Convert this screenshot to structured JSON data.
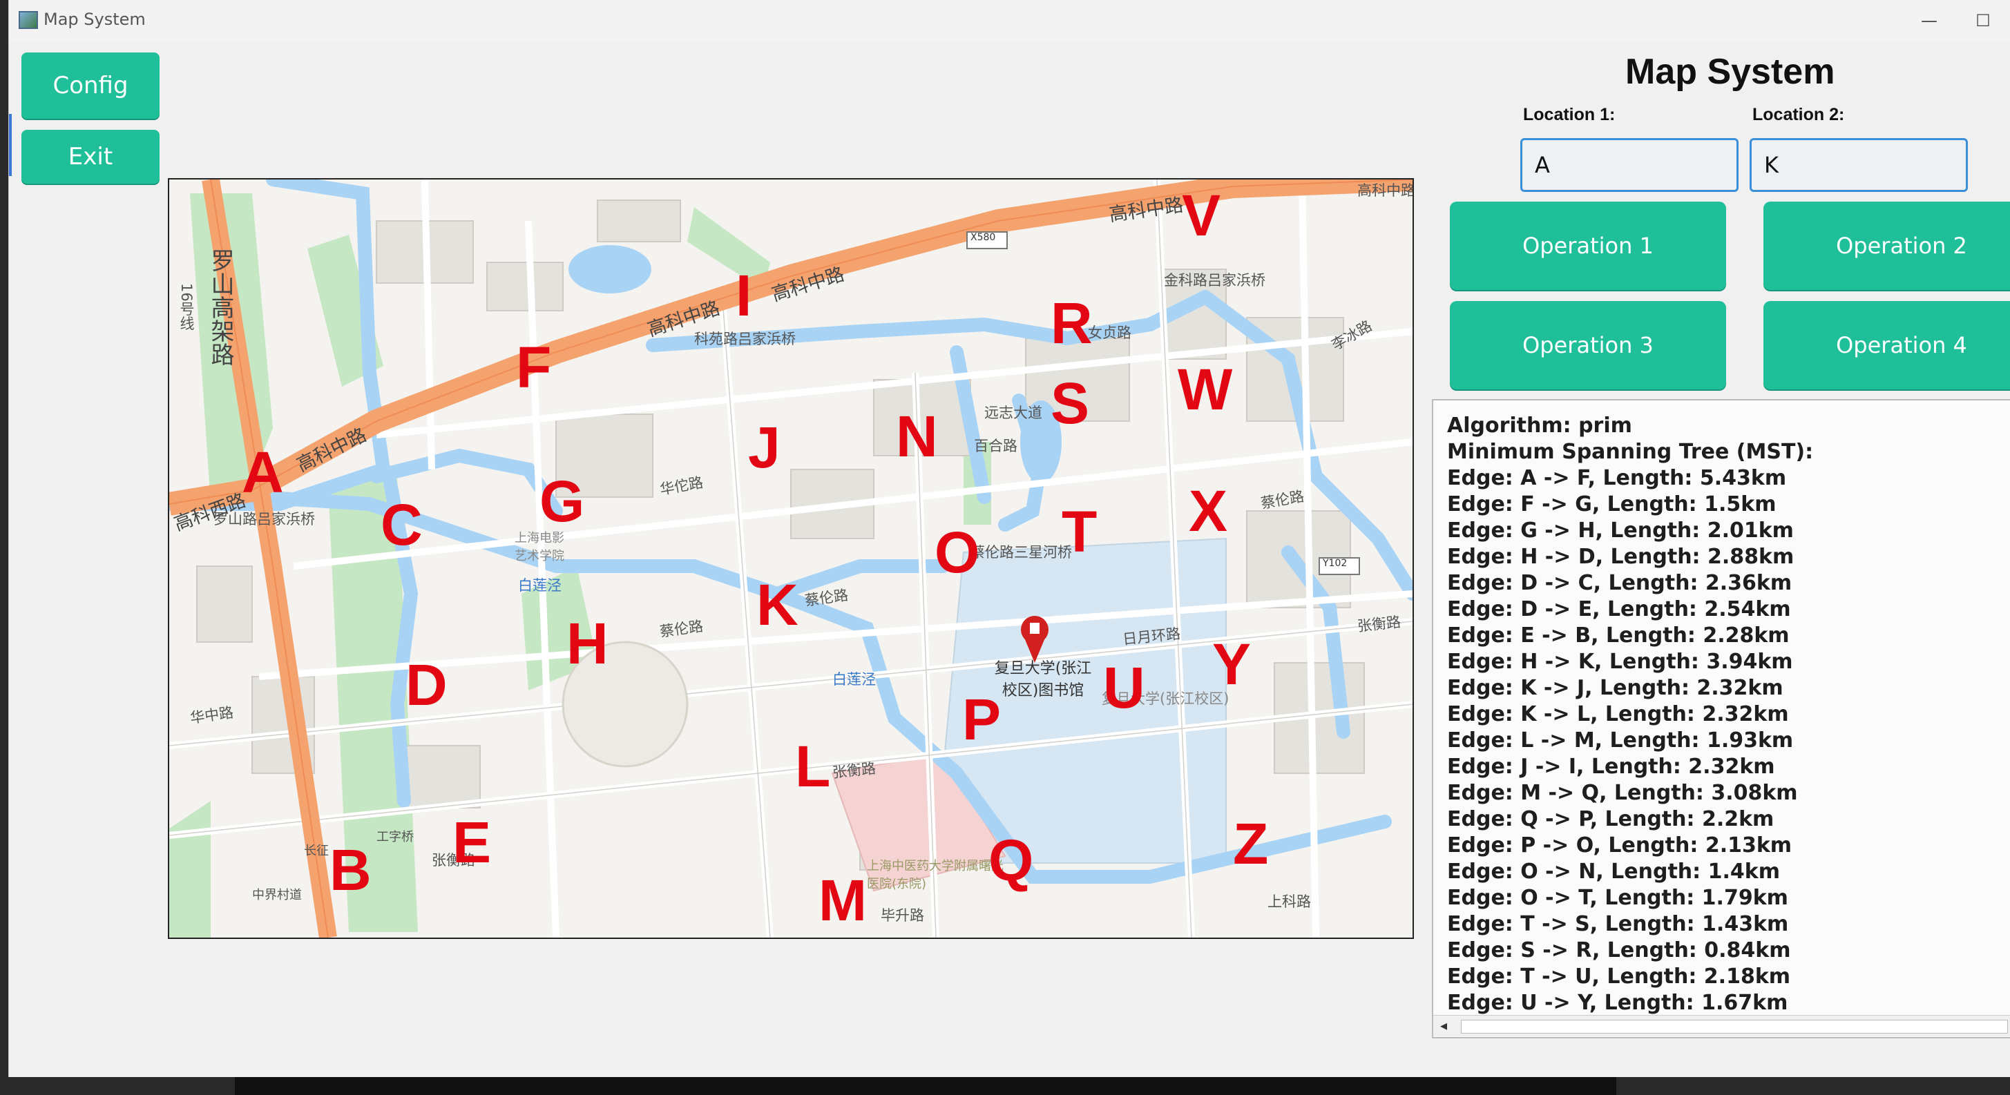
{
  "window": {
    "title": "Map System",
    "minimize_glyph": "—",
    "maximize_glyph": "☐"
  },
  "sidebar": {
    "config_label": "Config",
    "exit_label": "Exit"
  },
  "header": {
    "title": "Map System"
  },
  "locations": {
    "location1_label": "Location 1:",
    "location1_value": "A",
    "location2_label": "Location 2:",
    "location2_value": "K"
  },
  "operations": [
    {
      "label": "Operation 1"
    },
    {
      "label": "Operation 2"
    },
    {
      "label": "Operation 3"
    },
    {
      "label": "Operation 4"
    }
  ],
  "map": {
    "markers": [
      "A",
      "B",
      "C",
      "D",
      "E",
      "F",
      "G",
      "H",
      "I",
      "J",
      "K",
      "L",
      "M",
      "N",
      "O",
      "P",
      "Q",
      "R",
      "S",
      "T",
      "U",
      "V",
      "W",
      "X",
      "Y",
      "Z"
    ],
    "road_labels": {
      "gaoke_middle_1": "高科中路",
      "gaoke_middle_2": "高科中路",
      "gaoke_middle_3": "高科中路",
      "gaoke_middle_4": "高科中路",
      "gaoke_middle_5": "高科中路",
      "gaoke_west": "高科西路",
      "luoshan": "罗山高架路",
      "line16": "16号线",
      "x580": "X580",
      "y102": "Y102",
      "jinke_bridge": "金科路吕家浜桥",
      "keyuan_bridge": "科苑路吕家浜桥",
      "luoshan_bridge": "罗山路吕家浜桥",
      "huahua": "华佗路",
      "cailun_1": "蔡伦路",
      "cailun_2": "蔡伦路",
      "cailun_3": "蔡伦路",
      "cailun_bridge": "蔡伦路三星河桥",
      "zhangheng_1": "张衡路",
      "zhangheng_2": "张衡路",
      "zhangheng_3": "张衡路",
      "bailianjing_1": "白莲泾",
      "bailianjing_2": "白莲泾",
      "bisheng": "毕升路",
      "yuanzhi": "远志大道",
      "baihe": "百合路",
      "nvzhen": "女贞路",
      "riyuehuan": "日月环路",
      "fudan": "复旦大学(张江校区)图书馆",
      "fudan_campus": "复旦大学(张江校区)",
      "hospital": "上海中医药大学附属曙光医院(东院)",
      "film_school": "上海电影艺术学院",
      "gongzi": "工字桥",
      "zhongjiecun": "中界村道",
      "changzheng": "长征",
      "huazhong": "华中路",
      "shangke": "上科路",
      "lishui": "李冰路"
    }
  },
  "output": {
    "lines": [
      "Algorithm: prim",
      "Minimum Spanning Tree (MST):",
      "Edge: A -> F, Length: 5.43km",
      "Edge: F -> G, Length: 1.5km",
      "Edge: G -> H, Length: 2.01km",
      "Edge: H -> D, Length: 2.88km",
      "Edge: D -> C, Length: 2.36km",
      "Edge: D -> E, Length: 2.54km",
      "Edge: E -> B, Length: 2.28km",
      "Edge: H -> K, Length: 3.94km",
      "Edge: K -> J, Length: 2.32km",
      "Edge: K -> L, Length: 2.32km",
      "Edge: L -> M, Length: 1.93km",
      "Edge: J -> I, Length: 2.32km",
      "Edge: M -> Q, Length: 3.08km",
      "Edge: Q -> P, Length: 2.2km",
      "Edge: P -> O, Length: 2.13km",
      "Edge: O -> N, Length: 1.4km",
      "Edge: O -> T, Length: 1.79km",
      "Edge: T -> S, Length: 1.43km",
      "Edge: S -> R, Length: 0.84km",
      "Edge: T -> U, Length: 2.18km",
      "Edge: U -> Y, Length: 1.67km"
    ]
  },
  "colors": {
    "button": "#1fbf9a",
    "input_border": "#3a8fd8",
    "marker": "#e30613",
    "water": "#a9d3f5",
    "highway": "#f4a26e",
    "green": "#c6e7c4"
  }
}
